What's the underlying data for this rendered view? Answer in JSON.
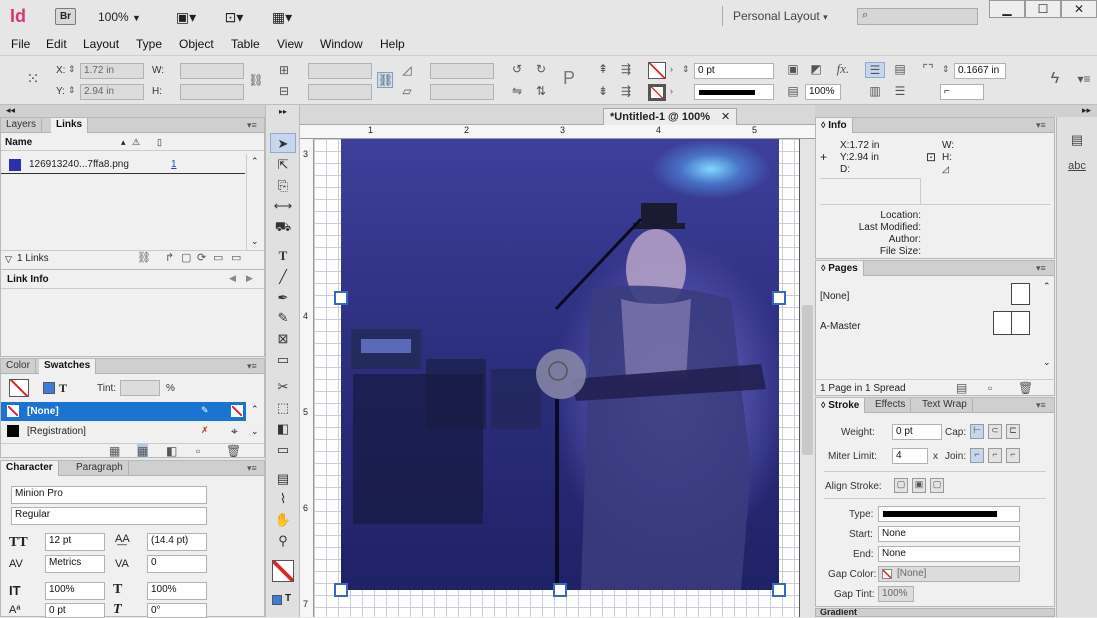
{
  "app": {
    "logo": "Id",
    "bridge": "Br",
    "zoom": "100%",
    "workspace": "Personal Layout"
  },
  "menu": [
    "File",
    "Edit",
    "Layout",
    "Type",
    "Object",
    "Table",
    "View",
    "Window",
    "Help"
  ],
  "control": {
    "x_label": "X:",
    "x_value": "1.72 in",
    "y_label": "Y:",
    "y_value": "2.94 in",
    "w_label": "W:",
    "h_label": "H:",
    "stroke_weight": "0 pt",
    "opacity": "100%",
    "fitting_value": "0.1667 in"
  },
  "layers_panel": {
    "tabs": [
      "Layers",
      "Links"
    ],
    "col_name": "Name",
    "link_file": "126913240...7ffa8.png",
    "link_page": "1",
    "links_count": "1 Links",
    "link_info": "Link Info"
  },
  "swatches": {
    "tabs": [
      "Color",
      "Swatches"
    ],
    "tint_label": "Tint:",
    "tint_value": "",
    "percent": "%",
    "rows": [
      "[None]",
      "[Registration]"
    ]
  },
  "character": {
    "tabs": [
      "Character",
      "Paragraph"
    ],
    "font": "Minion Pro",
    "style": "Regular",
    "size": "12 pt",
    "leading": "(14.4 pt)",
    "kerning": "Metrics",
    "tracking": "0",
    "vscale": "100%",
    "hscale": "100%",
    "baseline": "0 pt",
    "skew": "0°"
  },
  "doc": {
    "tab_title": "*Untitled-1 @ 100%",
    "ruler_marks": [
      "1",
      "2",
      "3",
      "4",
      "5"
    ],
    "vruler_marks": [
      "3",
      "4",
      "5",
      "6",
      "7"
    ]
  },
  "info_panel": {
    "title": "Info",
    "x": "X:1.72 in",
    "y": "Y:2.94 in",
    "d": "D:",
    "w": "W:",
    "h": "H:",
    "location": "Location:",
    "last_modified": "Last Modified:",
    "author": "Author:",
    "file_size": "File Size:"
  },
  "pages_panel": {
    "title": "Pages",
    "none": "[None]",
    "master": "A-Master",
    "status": "1 Page in 1 Spread"
  },
  "stroke_panel": {
    "tabs": [
      "Stroke",
      "Effects",
      "Text Wrap"
    ],
    "weight_label": "Weight:",
    "weight": "0 pt",
    "cap_label": "Cap:",
    "miter_label": "Miter Limit:",
    "miter": "4",
    "x": "x",
    "join_label": "Join:",
    "align_label": "Align Stroke:",
    "type_label": "Type:",
    "start_label": "Start:",
    "start": "None",
    "end_label": "End:",
    "end": "None",
    "gap_color_label": "Gap Color:",
    "gap_color": "[None]",
    "gap_tint_label": "Gap Tint:",
    "gap_tint": "100%"
  },
  "gradient_tab": "Gradient",
  "dock": {
    "text_icon": "abc"
  }
}
